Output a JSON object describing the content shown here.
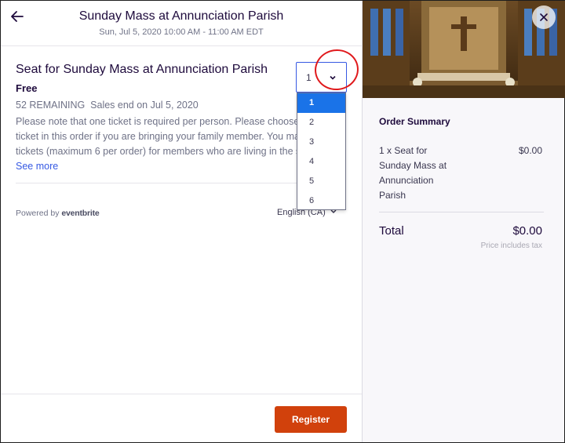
{
  "header": {
    "title": "Sunday Mass at Annunciation Parish",
    "subtitle": "Sun, Jul 5, 2020 10:00 AM - 11:00 AM EDT"
  },
  "ticket": {
    "name": "Seat for Sunday Mass at Annunciation Parish",
    "price": "Free",
    "remaining": "52 REMAINING  Sales end on Jul 5, 2020",
    "description_lines": [
      "Please note that one ticket is required per person. Please choose m",
      "ticket in this order if you are bringing your family member. You may",
      "tickets (maximum 6 per order) for members who are living in the sa"
    ],
    "see_more": "See more"
  },
  "quantity": {
    "selected": "1",
    "options": [
      "1",
      "2",
      "3",
      "4",
      "5",
      "6"
    ]
  },
  "powered_by": {
    "prefix": "Powered by",
    "brand": "eventbrite"
  },
  "language": {
    "label": "English (CA)"
  },
  "register_label": "Register",
  "order_summary": {
    "title": "Order Summary",
    "item_label": "1 x Seat for Sunday Mass at Annunciation Parish",
    "item_price": "$0.00",
    "total_label": "Total",
    "total_value": "$0.00",
    "tax_note": "Price includes tax"
  },
  "icons": {
    "back": "arrow-left-icon",
    "close": "close-icon",
    "chevron": "chevron-down-icon"
  },
  "colors": {
    "register": "#d1410c",
    "link": "#3659e3",
    "selected_option": "#1a73e8",
    "annotation": "#e0191c"
  }
}
